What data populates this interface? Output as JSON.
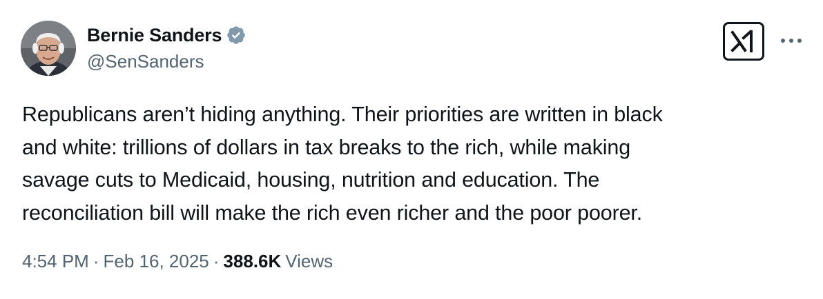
{
  "author": {
    "display_name": "Bernie Sanders",
    "handle": "@SenSanders",
    "verified": true,
    "verified_color": "#829aab"
  },
  "icons": {
    "verified": "verified-badge-icon",
    "grok": "grok-icon",
    "more": "more-options-icon"
  },
  "post": {
    "text": "Republicans aren’t hiding anything. Their priorities are written in black\nand white: trillions of dollars in tax breaks to the rich, while making\nsavage cuts to Medicaid, housing, nutrition and education. The\nreconciliation bill will make the rich even richer and the poor poorer."
  },
  "meta": {
    "time": "4:54 PM",
    "separator": "·",
    "date": "Feb 16, 2025",
    "views_count": "388.6K",
    "views_label": "Views"
  },
  "colors": {
    "text_primary": "#0f1419",
    "text_secondary": "#536471"
  }
}
